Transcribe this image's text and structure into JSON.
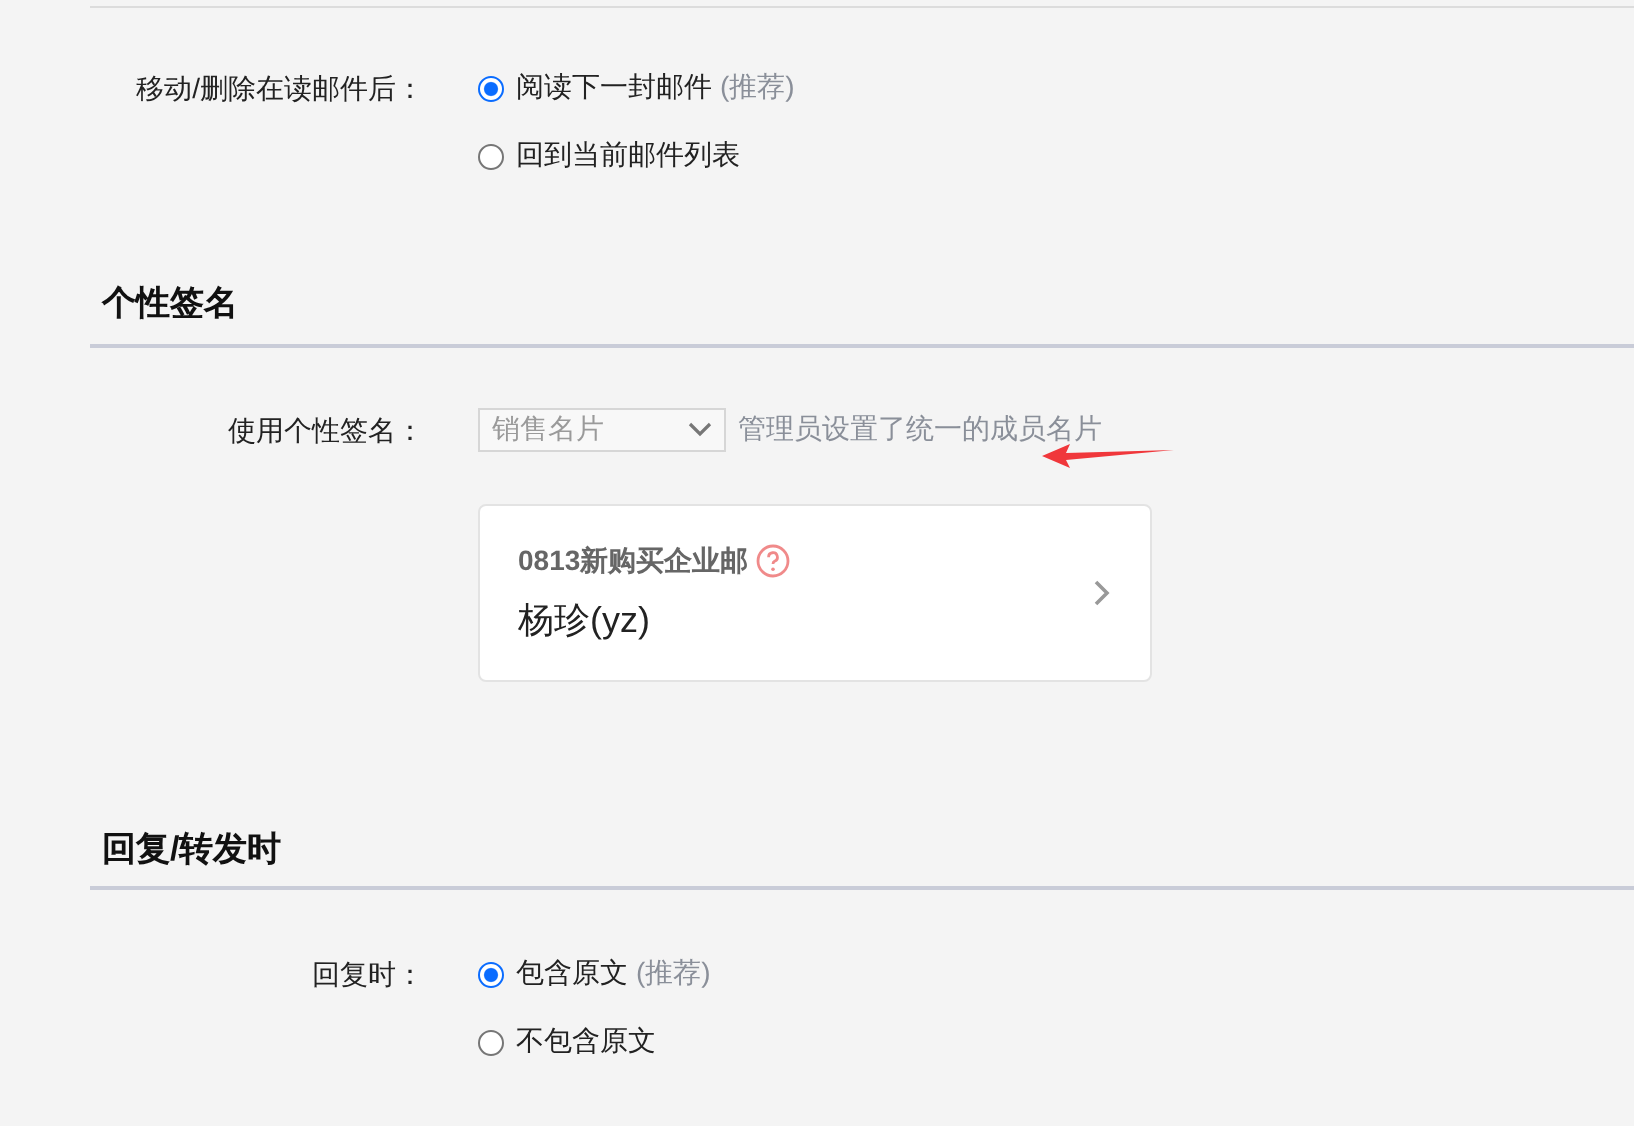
{
  "sections": [
    {
      "fields": [
        {
          "kind": "radio",
          "label": "移动/删除在读邮件后：",
          "options": [
            {
              "text": "阅读下一封邮件",
              "note": "(推荐)",
              "selected": true
            },
            {
              "text": "回到当前邮件列表",
              "selected": false
            }
          ]
        }
      ]
    },
    {
      "title": "个性签名",
      "fields": [
        {
          "kind": "signature",
          "label": "使用个性签名：",
          "select": {
            "value": "销售名片",
            "disabled": true
          },
          "hint": "管理员设置了统一的成员名片",
          "card": {
            "company": "0813新购买企业邮",
            "name": "杨珍(yz)"
          }
        }
      ]
    },
    {
      "title": "回复/转发时",
      "fields": [
        {
          "kind": "radio",
          "label": "回复时：",
          "options": [
            {
              "text": "包含原文",
              "note": "(推荐)",
              "selected": true
            },
            {
              "text": "不包含原文",
              "selected": false
            }
          ]
        }
      ]
    }
  ]
}
